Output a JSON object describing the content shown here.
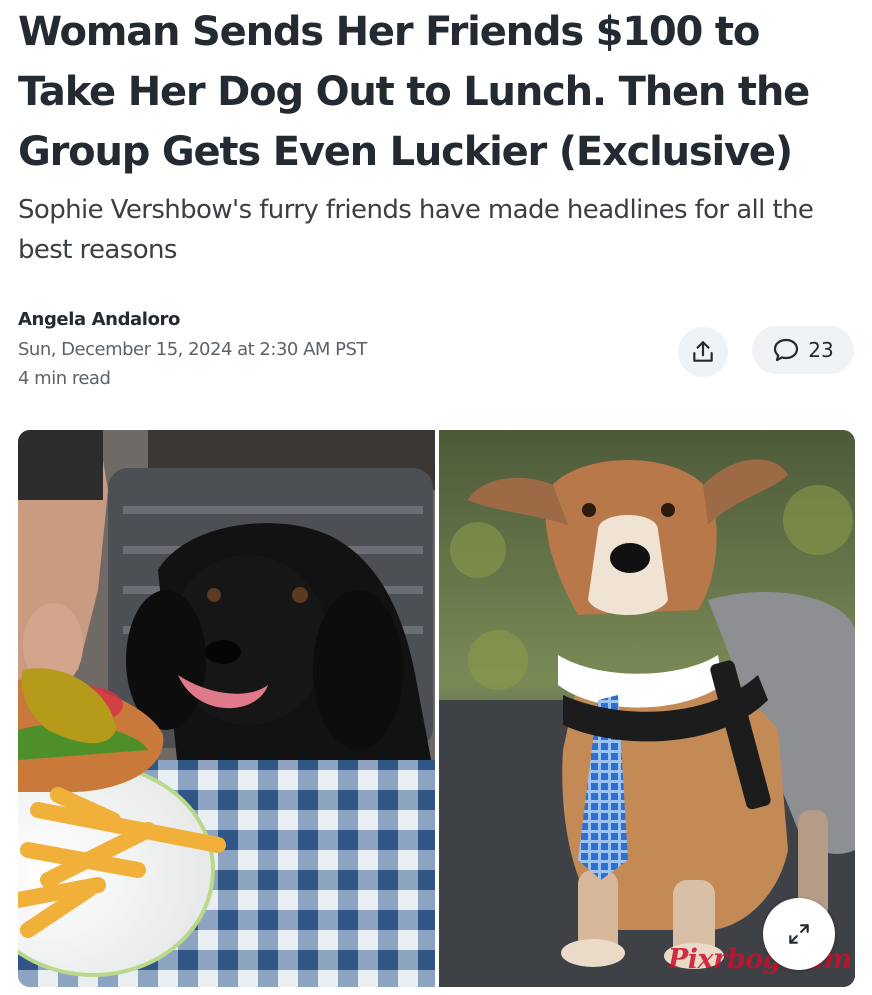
{
  "article": {
    "headline": "Woman Sends Her Friends $100 to Take Her Dog Out to Lunch. Then the Group Gets Even Luckier (Exclusive)",
    "subheadline": "Sophie Vershbow's furry friends have made headlines for all the best reasons",
    "author": "Angela Andaloro",
    "date": "Sun, December 15, 2024 at 2:30 AM PST",
    "read_time": "4 min read"
  },
  "actions": {
    "share_icon": "share-upload-icon",
    "comment_icon": "speech-bubble-icon",
    "comment_count": "23",
    "expand_icon": "expand-arrows-icon"
  },
  "hero_image": {
    "left_photo": "black dog at outdoor table with burger and fries",
    "right_photo": "brown and gray dog wearing a blue plaid tie and harness",
    "watermark": "Pixrbog.com"
  },
  "colors": {
    "text": "#232a31",
    "muted": "#5b636a",
    "button_bg": "#f0f3f5",
    "watermark": "#c8102e"
  }
}
